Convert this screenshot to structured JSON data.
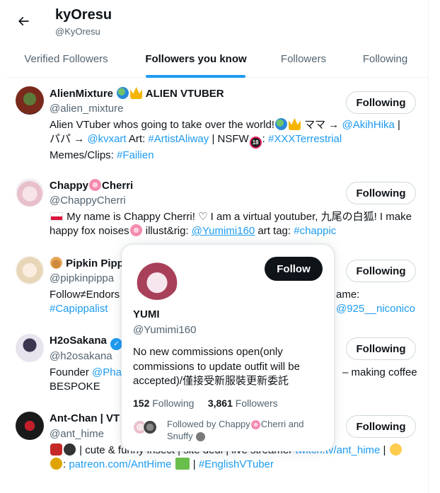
{
  "header": {
    "name": "kyOresu",
    "handle": "@KyOresu"
  },
  "tabs": [
    {
      "label": "Verified Followers"
    },
    {
      "label": "Followers you know"
    },
    {
      "label": "Followers"
    },
    {
      "label": "Following"
    }
  ],
  "users": [
    {
      "name_a": "AlienMixture ",
      "name_b": " ALIEN VTUBER",
      "handle": "@alien_mixture",
      "button": "Following",
      "bio": {
        "l1a": "Alien VTuber whos going to take over the world!",
        "l1b": " ママ → ",
        "l1c": "@AkihHika",
        "l1d": " |",
        "l2a": "パパ → ",
        "l2b": "@kvxart",
        "l2c": " Art: ",
        "l2d": "#ArtistAliway",
        "l2e": " | NSFW",
        "l2f": ": ",
        "l2g": "#XXXTerrestrial",
        "l3a": "Memes/Clips: ",
        "l3b": "#Failien"
      }
    },
    {
      "name_a": "Chappy",
      "name_b": "Cherri",
      "handle": "@ChappyCherri",
      "button": "Following",
      "bio": {
        "l1a": " My name is Chappy Cherri! ♡ I am a virtual youtuber, 九尾の白狐! I make",
        "l2a": "happy fox noises",
        "l2b": " illust&rig: ",
        "l2c": "@Yumimi160",
        "l2d": " art tag: ",
        "l2e": "#chappic"
      }
    },
    {
      "name_a": " Pipkin Pipp",
      "handle": "@pipkinpippa",
      "button": "Following",
      "bio": {
        "l1a": "Follow≠Endors",
        "l1b": "ame:",
        "l2a": "#Capippalist",
        "l2b": "@925__niconico"
      }
    },
    {
      "name_a": "H2oSakana",
      "handle": "@h2osakana",
      "button": "Following",
      "bio": {
        "l1a": "Founder ",
        "l1b": "@Phas",
        "l1c": "– making coffee",
        "l2a": "BESPOKE"
      }
    },
    {
      "name_a": "Ant-Chan | VT",
      "handle": "@ant_hime",
      "button": "Following",
      "bio": {
        "l1a": " | cute & funny insect | site dedi | live streamer ",
        "l1b": "twitch.tv/ant_hime",
        "l1c": " |",
        "l2a": ": ",
        "l2b": "patreon.com/AntHime",
        "l2c": " | ",
        "l2d": "#EnglishVTuber"
      }
    }
  ],
  "popup": {
    "name": "YUMI",
    "handle": "@Yumimi160",
    "button": "Follow",
    "bio": "No new commissions open(only commissions to update outfit will be accepted)/僅接受新服裝更新委託",
    "following_count": "152",
    "following_label": "Following",
    "followers_count": "3,861",
    "followers_label": "Followers",
    "mutual_a": "Followed by Chappy",
    "mutual_b": "Cherri and",
    "mutual_c": "Snuffy"
  },
  "colors": {
    "accent": "#1d9bf0",
    "text": "#0f1419",
    "muted": "#536471",
    "border": "#cfd9de"
  }
}
